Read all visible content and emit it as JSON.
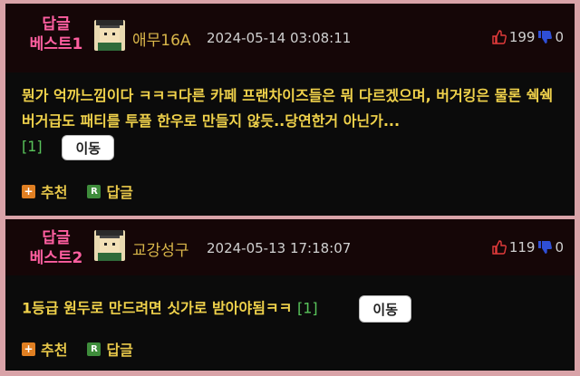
{
  "comments": [
    {
      "best_label": "답글 베스트1",
      "best_line1": "답글",
      "best_line2": "베스트1",
      "nickname": "애무16A",
      "date": "2024-05-14 03:08:11",
      "upvotes": "199",
      "downvotes": "0",
      "text": "뭔가 억까느낌이다 ㅋㅋㅋ다른 카페 프랜차이즈들은 뭐 다르겠으며, 버거킹은 물론 쉑쉑버거급도 패티를 투플 한우로 만들지 않듯..당연한거 아닌가...",
      "reply_count": "[1]",
      "move_label": "이동",
      "recommend_label": "추천",
      "reply_label": "답글"
    },
    {
      "best_label": "답글 베스트2",
      "best_line1": "답글",
      "best_line2": "베스트2",
      "nickname": "교강성구",
      "date": "2024-05-13 17:18:07",
      "upvotes": "119",
      "downvotes": "0",
      "text": "1등급 원두로 만드려면 싯가로 받아야됨ㅋㅋ",
      "reply_count": "[1]",
      "move_label": "이동",
      "recommend_label": "추천",
      "reply_label": "답글"
    }
  ],
  "icons": {
    "thumb_up": "thumbs-up-icon",
    "thumb_down": "thumbs-down-icon",
    "plus": "plus-icon",
    "reply": "reply-r-icon"
  },
  "colors": {
    "best": "#ff5fa0",
    "nickname": "#d9b64a",
    "body_text": "#f0d24b",
    "reply_count": "#59c45b",
    "thumb_up": "#e33b3b",
    "thumb_down": "#2f4fd6"
  }
}
